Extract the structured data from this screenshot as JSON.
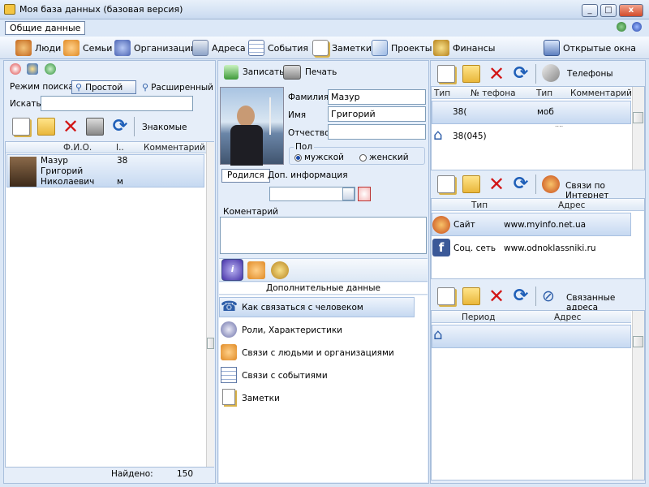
{
  "window": {
    "title": "Моя база данных (базовая версия)",
    "minimize": "_",
    "maximize": "□",
    "close": "x"
  },
  "menu": {
    "tab": "Общие данные"
  },
  "toolbar": {
    "items": [
      "Люди",
      "Семьи",
      "Организации",
      "Адреса",
      "События",
      "Заметки",
      "Проекты",
      "Финансы"
    ],
    "open_windows": "Открытые окна"
  },
  "left": {
    "search_mode_label": "Режим поиска:",
    "mode_simple": "Простой",
    "mode_advanced": "Расширенный",
    "search_label": "Искать",
    "search_value": "",
    "group_label": "Знакомые",
    "columns": [
      "Ф.И.О.",
      "I..",
      "Комментарий"
    ],
    "rows": [
      {
        "name_lines": [
          "Мазур",
          "Григорий",
          "Николаевич"
        ],
        "age": "38",
        "gender": "м",
        "comment": ""
      }
    ],
    "found_label": "Найдено:",
    "found_count": "150"
  },
  "middle": {
    "save_label": "Записать",
    "print_label": "Печать",
    "surname_label": "Фамилия",
    "surname_value": "Мазур",
    "name_label": "Имя",
    "name_value": "Григорий",
    "patronymic_label": "Отчество",
    "patronymic_value": "",
    "gender_label": "Пол",
    "gender_male": "мужской",
    "gender_female": "женский",
    "born_tab": "Родился",
    "extra_tab": "Доп. информация",
    "comment_label": "Коментарий",
    "comment_value": "",
    "extra_header": "Дополнительные данные",
    "extra_items": [
      "Как связаться с человеком",
      "Роли, Характеристики",
      "Связи с людьми и организациями",
      "Связи с событиями",
      "Заметки"
    ]
  },
  "phones": {
    "title": "Телефоны",
    "columns": [
      "Тип",
      "№ тефона",
      "Тип",
      "Комментарий"
    ],
    "rows": [
      {
        "number": "38(",
        "type": "моб"
      },
      {
        "number": "38(045)",
        "type": ""
      }
    ],
    "overflow_text": "...."
  },
  "internet": {
    "title": "Связи по Интернет",
    "columns": [
      "Тип",
      "Адрес"
    ],
    "rows": [
      {
        "type": "Сайт",
        "address": "www.myinfo.net.ua"
      },
      {
        "type": "Соц. сеть",
        "address": "www.odnoklassniki.ru"
      }
    ]
  },
  "addresses": {
    "title": "Связанные адреса",
    "columns": [
      "Период",
      "Адрес"
    ],
    "rows": [
      {
        "period": "",
        "address": ""
      }
    ]
  },
  "colors": {
    "accent": "#2f6bc6",
    "selection": "#c6d9f1",
    "close": "#d24a2a"
  }
}
